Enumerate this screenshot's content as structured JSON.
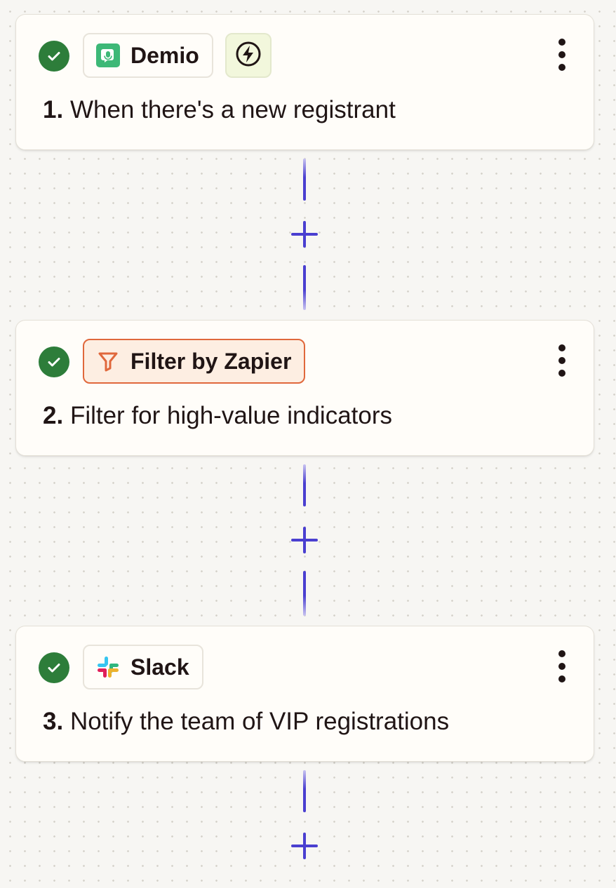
{
  "colors": {
    "accent": "#4a3fd0",
    "success": "#2d7d3a",
    "filter_orange": "#e0683c",
    "trigger_bg": "#f2f7dc",
    "demio_green": "#3db877",
    "text": "#201515"
  },
  "steps": [
    {
      "number": "1.",
      "title": "When there's a new registrant",
      "app_name": "Demio",
      "app_icon": "demio-icon",
      "status": "complete",
      "status_icon": "checkmark-icon",
      "trigger_icon": "lightning-bolt-icon",
      "menu_icon": "more-vertical-icon"
    },
    {
      "number": "2.",
      "title": "Filter for high-value indicators",
      "app_name": "Filter by Zapier",
      "app_icon": "filter-funnel-icon",
      "status": "complete",
      "status_icon": "checkmark-icon",
      "menu_icon": "more-vertical-icon"
    },
    {
      "number": "3.",
      "title": "Notify the team of VIP registrations",
      "app_name": "Slack",
      "app_icon": "slack-icon",
      "status": "complete",
      "status_icon": "checkmark-icon",
      "menu_icon": "more-vertical-icon"
    }
  ],
  "connectors": {
    "add_step_icon": "plus-icon"
  }
}
